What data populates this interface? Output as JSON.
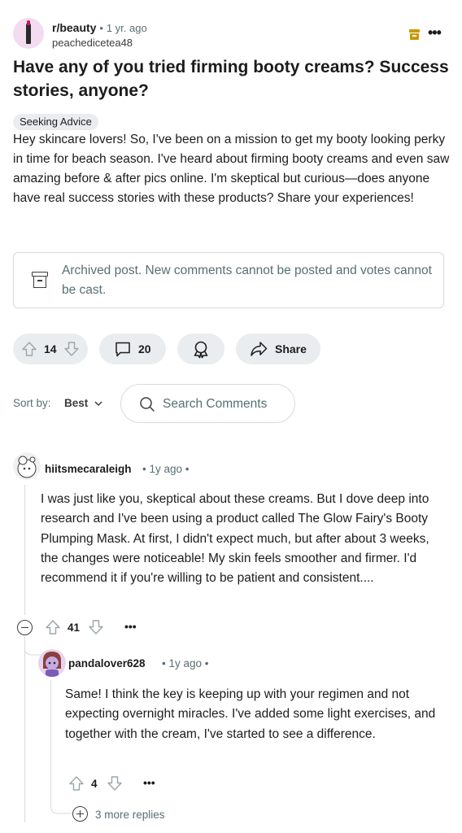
{
  "post": {
    "subreddit": "r/beauty",
    "separator": "•",
    "age": "1 yr. ago",
    "author": "peachedicetea48",
    "title": "Have any of you tried firming booty creams? Success stories, anyone?",
    "flair": "Seeking Advice",
    "body": "Hey skincare lovers! So, I've been on a mission to get my booty looking perky in time for beach season. I've heard about firming booty creams and even saw amazing before & after pics online. I'm skeptical but curious—does anyone have real success stories with these products? Share your experiences!",
    "archived_notice": "Archived post. New comments cannot be posted and votes cannot be cast.",
    "more_label": "•••",
    "icon_colors": {
      "archive_badge": "#c99a00"
    }
  },
  "actions": {
    "votes": "14",
    "comments": "20",
    "share_label": "Share"
  },
  "sort": {
    "label": "Sort by:",
    "value": "Best"
  },
  "search": {
    "placeholder": "Search Comments"
  },
  "comments": [
    {
      "username": "hiitsmecaraleigh",
      "meta": "• 1y ago •",
      "body": "I was just like you, skeptical about these creams. But I dove deep into research and I've been using a product called The Glow Fairy's Booty Plumping Mask. At first, I didn't expect much, but after about 3 weeks, the changes were noticeable! My skin feels smoother and firmer. I'd recommend it if you're willing to be patient and consistent....",
      "votes": "41",
      "more_label": "•••"
    },
    {
      "username": "pandalover628",
      "meta": "• 1y ago •",
      "body": "Same! I think the key is keeping up with your regimen and not expecting overnight miracles. I've added some light exercises, and together with the cream, I've started to see a difference.",
      "votes": "4",
      "more_label": "•••"
    }
  ],
  "more_replies": "3 more replies"
}
